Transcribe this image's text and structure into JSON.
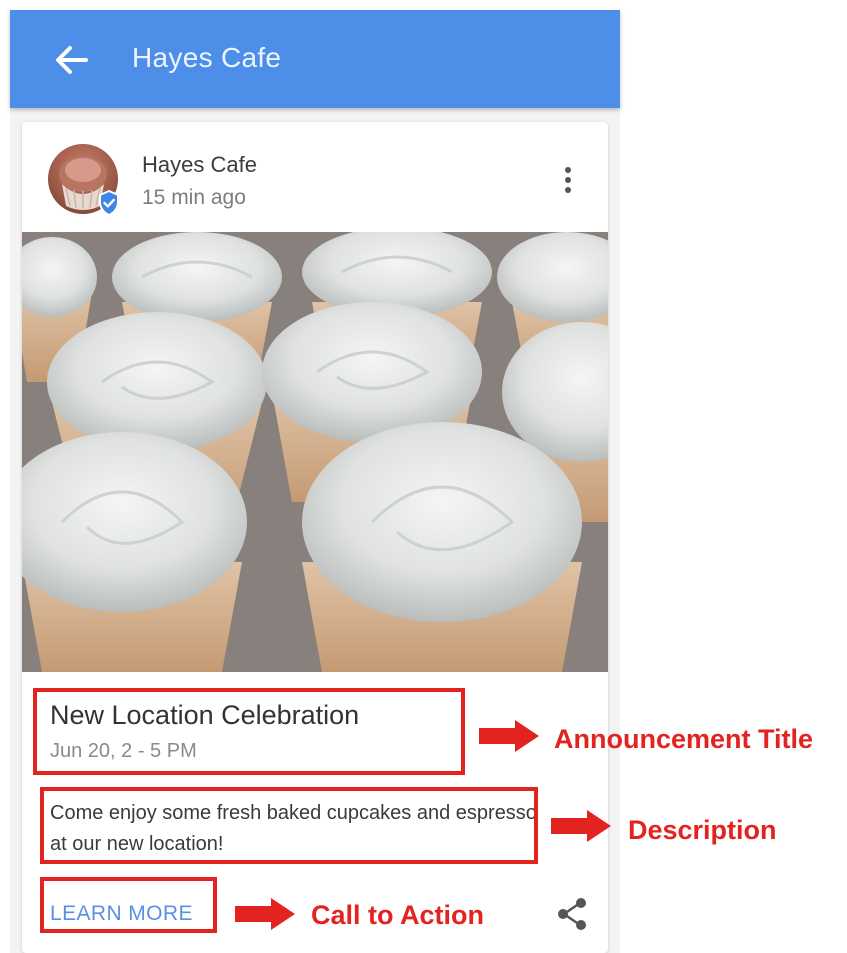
{
  "appbar": {
    "title": "Hayes Cafe",
    "color": "#4c8ee8"
  },
  "post": {
    "author": "Hayes Cafe",
    "time": "15 min ago",
    "title": "New Location Celebration",
    "date": "Jun 20, 2 - 5 PM",
    "description": "Come enjoy some fresh baked cupcakes and espresso at our new location!",
    "cta_label": "LEARN MORE"
  },
  "annotations": {
    "title_label": "Announcement Title",
    "description_label": "Description",
    "cta_label": "Call to Action",
    "color": "#e32320"
  },
  "icons": {
    "back": "arrow-left-icon",
    "verified": "verified-badge-icon",
    "more": "more-vert-icon",
    "share": "share-icon"
  }
}
